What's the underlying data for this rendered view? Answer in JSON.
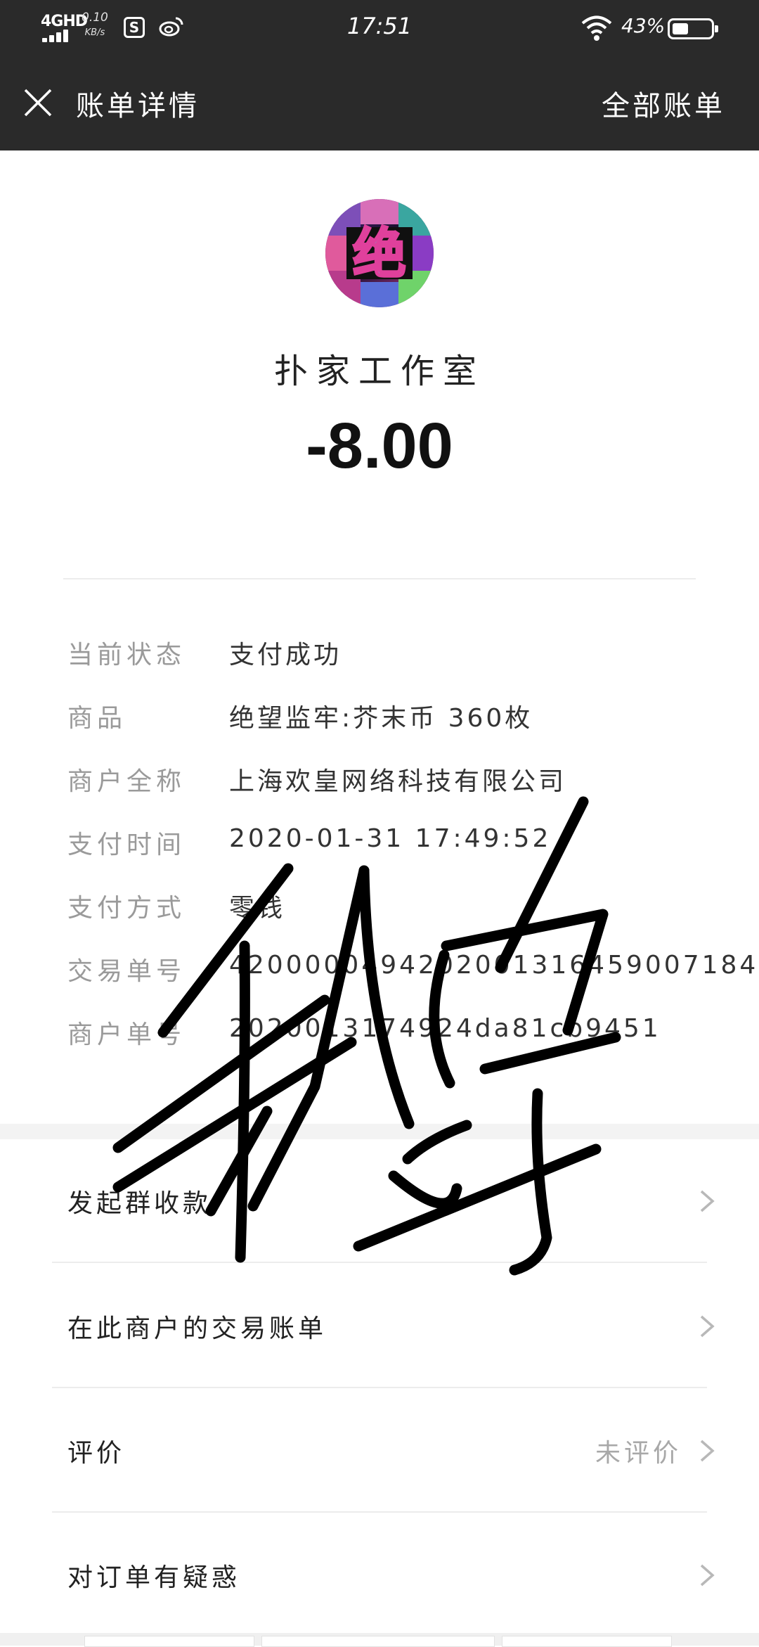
{
  "status_bar": {
    "network": "4GHD",
    "speed_value": "0.10",
    "speed_unit": "KB/s",
    "time": "17:51",
    "battery_percent": "43%",
    "battery_level": 0.43,
    "icons": [
      "signal-icon",
      "app-notification-icon",
      "weibo-icon",
      "wifi-icon",
      "battery-icon"
    ]
  },
  "nav": {
    "title": "账单详情",
    "all_bills": "全部账单",
    "close_icon": "close-icon"
  },
  "merchant": {
    "name": "扑家工作室",
    "avatar_char": "绝",
    "amount": "-8.00"
  },
  "details": [
    {
      "label": "当前状态",
      "value": "支付成功"
    },
    {
      "label": "商品",
      "value": "绝望监牢:芥末币 360枚"
    },
    {
      "label": "商户全称",
      "value": "上海欢皇网络科技有限公司"
    },
    {
      "label": "支付时间",
      "value": "2020-01-31 17:49:52"
    },
    {
      "label": "支付方式",
      "value": "零钱"
    },
    {
      "label": "交易单号",
      "value": "4200000494202001316459007184"
    },
    {
      "label": "商户单号",
      "value": "2020013174924da81cb9451"
    }
  ],
  "menu": [
    {
      "label": "发起群收款",
      "right": ""
    },
    {
      "label": "在此商户的交易账单",
      "right": ""
    },
    {
      "label": "评价",
      "right": "未评价"
    },
    {
      "label": "对订单有疑惑",
      "right": ""
    }
  ],
  "colors": {
    "header_bg": "#2a2a2a",
    "label_gray": "#9a9a9a",
    "signature": "#000000"
  }
}
